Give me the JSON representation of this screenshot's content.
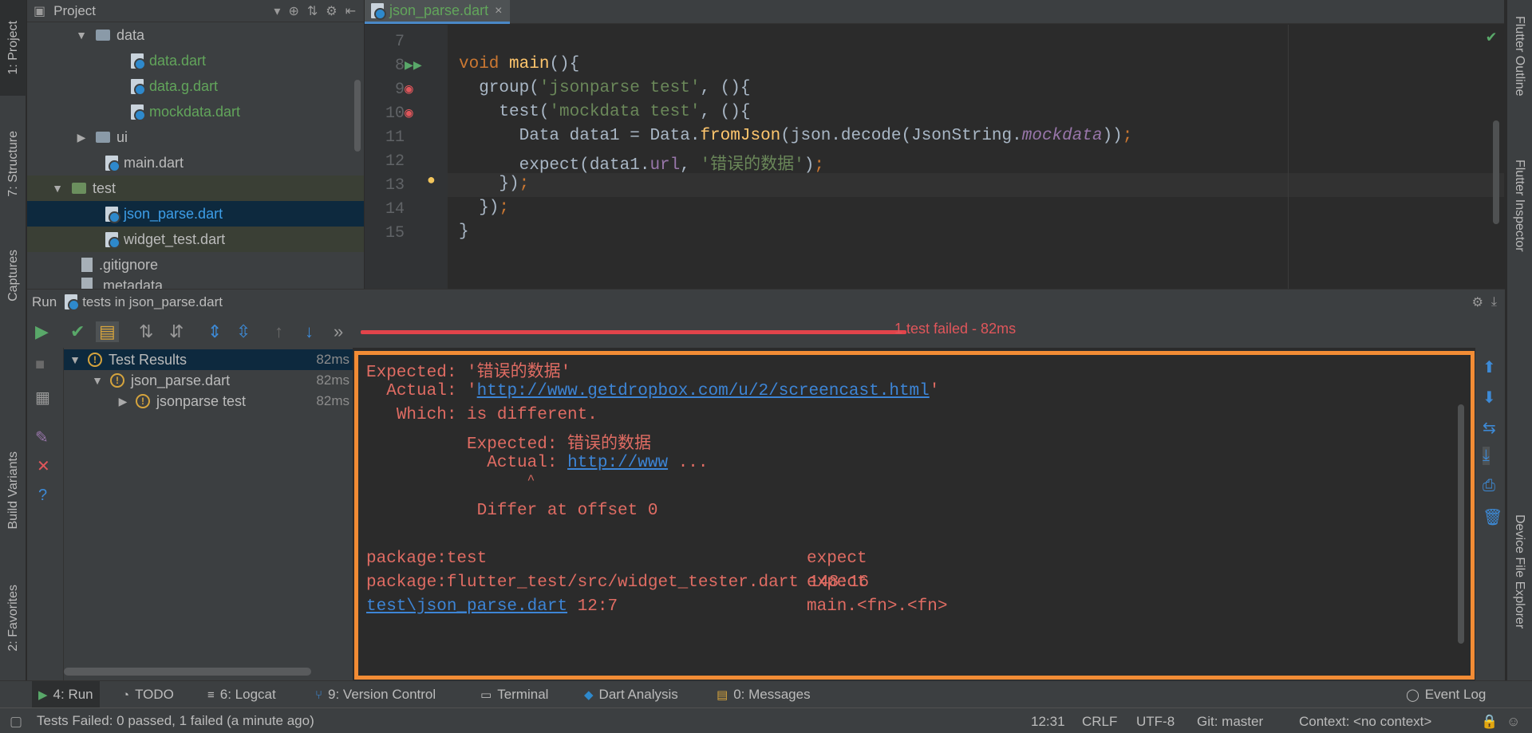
{
  "project_panel": {
    "title": "Project",
    "tree": [
      {
        "label": "data",
        "type": "folder",
        "expanded": true
      },
      {
        "label": "data.dart",
        "type": "dart"
      },
      {
        "label": "data.g.dart",
        "type": "dart"
      },
      {
        "label": "mockdata.dart",
        "type": "dart"
      },
      {
        "label": "ui",
        "type": "folder",
        "expanded": false
      },
      {
        "label": "main.dart",
        "type": "dart"
      },
      {
        "label": "test",
        "type": "folder",
        "expanded": true
      },
      {
        "label": "json_parse.dart",
        "type": "dart",
        "selected": true
      },
      {
        "label": "widget_test.dart",
        "type": "dart"
      },
      {
        "label": ".gitignore",
        "type": "file"
      },
      {
        "label": ".metadata",
        "type": "file"
      }
    ]
  },
  "left_tool_strip": {
    "project": "1: Project",
    "structure": "7: Structure",
    "captures": "Captures",
    "build_variants": "Build Variants",
    "favorites": "2: Favorites"
  },
  "right_tool_strip": {
    "flutter_outline": "Flutter Outline",
    "flutter_inspector": "Flutter Inspector",
    "device_file_explorer": "Device File Explorer"
  },
  "editor": {
    "tab_label": "json_parse.dart",
    "line_numbers": [
      "7",
      "8",
      "9",
      "10",
      "11",
      "12",
      "13",
      "14",
      "15"
    ]
  },
  "run_panel": {
    "title": "Run",
    "config": "tests in json_parse.dart",
    "status": "1 test failed - 82ms",
    "test_tree": [
      {
        "label": "Test Results",
        "time": "82ms"
      },
      {
        "label": "json_parse.dart",
        "time": "82ms"
      },
      {
        "label": "jsonparse test",
        "time": "82ms"
      }
    ],
    "console": {
      "expected_label": "Expected: ",
      "expected_value": "'错误的数据'",
      "actual_label": "Actual: ",
      "actual_quote": "'",
      "actual_link": "http://www.getdropbox.com/u/2/screencast.html",
      "which": "Which: is different.",
      "inner_expected": "Expected: 错误的数据",
      "inner_actual_label": "Actual: ",
      "inner_actual_link": "http://www",
      "inner_actual_rest": " ...",
      "caret": "^",
      "differ": "Differ at offset 0",
      "stack": [
        {
          "location": "package:test",
          "member": "expect"
        },
        {
          "location": "package:flutter_test/src/widget_tester.dart 148:16",
          "member": "expect"
        },
        {
          "location_link": "test\\json_parse.dart",
          "location_rest": " 12:7",
          "member": "main.<fn>.<fn>"
        }
      ]
    }
  },
  "bottom_tabs": {
    "run": "4: Run",
    "todo": "TODO",
    "logcat": "6: Logcat",
    "version_control": "9: Version Control",
    "terminal": "Terminal",
    "dart_analysis": "Dart Analysis",
    "messages": "0: Messages",
    "event_log": "Event Log"
  },
  "status_bar": {
    "message": "Tests Failed: 0 passed, 1 failed (a minute ago)",
    "position": "12:31",
    "line_sep": "CRLF",
    "encoding": "UTF-8",
    "git": "Git: master",
    "context": "Context: <no context>"
  },
  "colors": {
    "accent_orange": "#f28c35",
    "error_red": "#e0565b",
    "link_blue": "#3d85d6",
    "dart_green": "#62a55b"
  }
}
